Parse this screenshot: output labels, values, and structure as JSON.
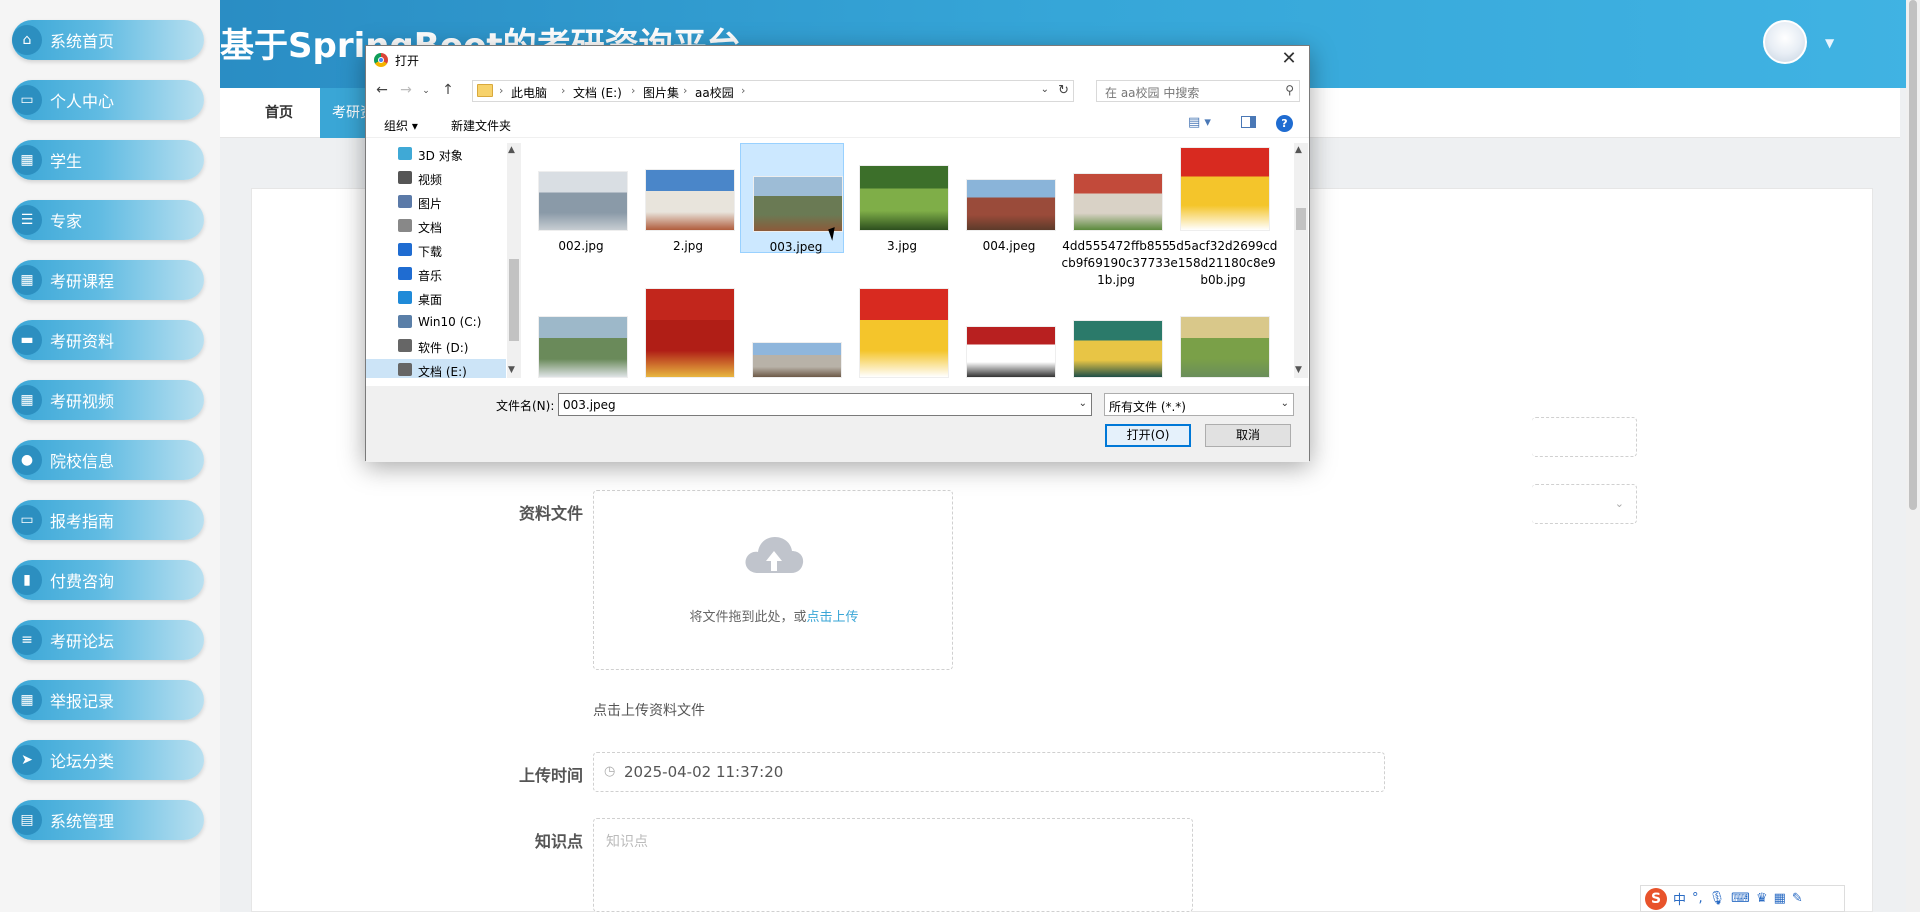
{
  "app": {
    "title": "基于SpringBoot的考研资询平台"
  },
  "sidebar": {
    "items": [
      {
        "label": "系统首页",
        "icon": "home-icon"
      },
      {
        "label": "个人中心",
        "icon": "profile-icon"
      },
      {
        "label": "学生",
        "icon": "grid-icon"
      },
      {
        "label": "专家",
        "icon": "list-icon"
      },
      {
        "label": "考研课程",
        "icon": "grid-icon"
      },
      {
        "label": "考研资料",
        "icon": "book-icon"
      },
      {
        "label": "考研视频",
        "icon": "grid-icon"
      },
      {
        "label": "院校信息",
        "icon": "bulb-icon"
      },
      {
        "label": "报考指南",
        "icon": "monitor-icon"
      },
      {
        "label": "付费咨询",
        "icon": "book-open-icon"
      },
      {
        "label": "考研论坛",
        "icon": "sliders-icon"
      },
      {
        "label": "举报记录",
        "icon": "grid-icon"
      },
      {
        "label": "论坛分类",
        "icon": "send-icon"
      },
      {
        "label": "系统管理",
        "icon": "clipboard-icon"
      }
    ]
  },
  "topnav": {
    "home": "首页",
    "current": "考研资"
  },
  "form": {
    "file_label": "资料文件",
    "upload_hint": "将文件拖到此处，或",
    "upload_link": "点击上传",
    "upload_tip": "点击上传资料文件",
    "time_label": "上传时间",
    "time_value": "2025-04-02 11:37:20",
    "kp_label": "知识点",
    "kp_placeholder": "知识点"
  },
  "dialog": {
    "title": "打开",
    "breadcrumbs": [
      "此电脑",
      "文档 (E:)",
      "图片集",
      "aa校园"
    ],
    "search_placeholder": "在 aa校园 中搜索",
    "organize": "组织 ▾",
    "new_folder": "新建文件夹",
    "tree": [
      {
        "label": "3D 对象",
        "color": "#3fa9d6"
      },
      {
        "label": "视频",
        "color": "#555555"
      },
      {
        "label": "图片",
        "color": "#5b7aa8"
      },
      {
        "label": "文档",
        "color": "#888888"
      },
      {
        "label": "下载",
        "color": "#1f6cd1"
      },
      {
        "label": "音乐",
        "color": "#1f6cd1"
      },
      {
        "label": "桌面",
        "color": "#1f8ad8"
      },
      {
        "label": "Win10 (C:)",
        "color": "#5a7fa8"
      },
      {
        "label": "软件 (D:)",
        "color": "#666666"
      },
      {
        "label": "文档 (E:)",
        "color": "#666666"
      }
    ],
    "files": [
      {
        "name": "002.jpg",
        "colors": [
          "#d9dee3",
          "#8a9aa8",
          "#c7cdd2"
        ]
      },
      {
        "name": "2.jpg",
        "colors": [
          "#4a86c9",
          "#e8e4dc",
          "#b05c3c"
        ]
      },
      {
        "name": "003.jpeg",
        "colors": [
          "#9dbcd6",
          "#6a7a54",
          "#8c5a3a"
        ]
      },
      {
        "name": "3.jpg",
        "colors": [
          "#3c6f2a",
          "#7fae48",
          "#2d4f1e"
        ]
      },
      {
        "name": "004.jpeg",
        "colors": [
          "#8ab4d9",
          "#9a4b3a",
          "#5d3b2b"
        ]
      },
      {
        "name": "4dd555472ffb855cb9f69190c377331b.jpg",
        "colors": [
          "#c24a3a",
          "#d9d2c6",
          "#5b8a3c"
        ]
      },
      {
        "name": "5d5acf32d2699cde158d21180c8e9b0b.jpg",
        "colors": [
          "#d82a20",
          "#f4c52b",
          "#ffffff"
        ]
      },
      {
        "name": "",
        "colors": [
          "#9db8c9",
          "#6a8a5a",
          "#dfe3e6"
        ]
      },
      {
        "name": "",
        "colors": [
          "#c2261c",
          "#b01e16",
          "#e8b640"
        ]
      },
      {
        "name": "",
        "colors": [
          "#8fb6dc",
          "#b8b2a8",
          "#6d5a48"
        ]
      },
      {
        "name": "",
        "colors": [
          "#d82a20",
          "#f4c52b",
          "#ffffff"
        ]
      },
      {
        "name": "",
        "colors": [
          "#b82020",
          "#ffffff",
          "#333333"
        ]
      },
      {
        "name": "",
        "colors": [
          "#2b7a6a",
          "#e8c545",
          "#1f4f48"
        ]
      },
      {
        "name": "",
        "colors": [
          "#d9c88a",
          "#7aa048",
          "#6a8e5a"
        ]
      }
    ],
    "filename_label": "文件名(N):",
    "filename_value": "003.jpeg",
    "filetype_value": "所有文件 (*.*)",
    "open_label": "打开(O)",
    "cancel_label": "取消"
  },
  "ime": {
    "logo": "S",
    "lang": "中"
  }
}
